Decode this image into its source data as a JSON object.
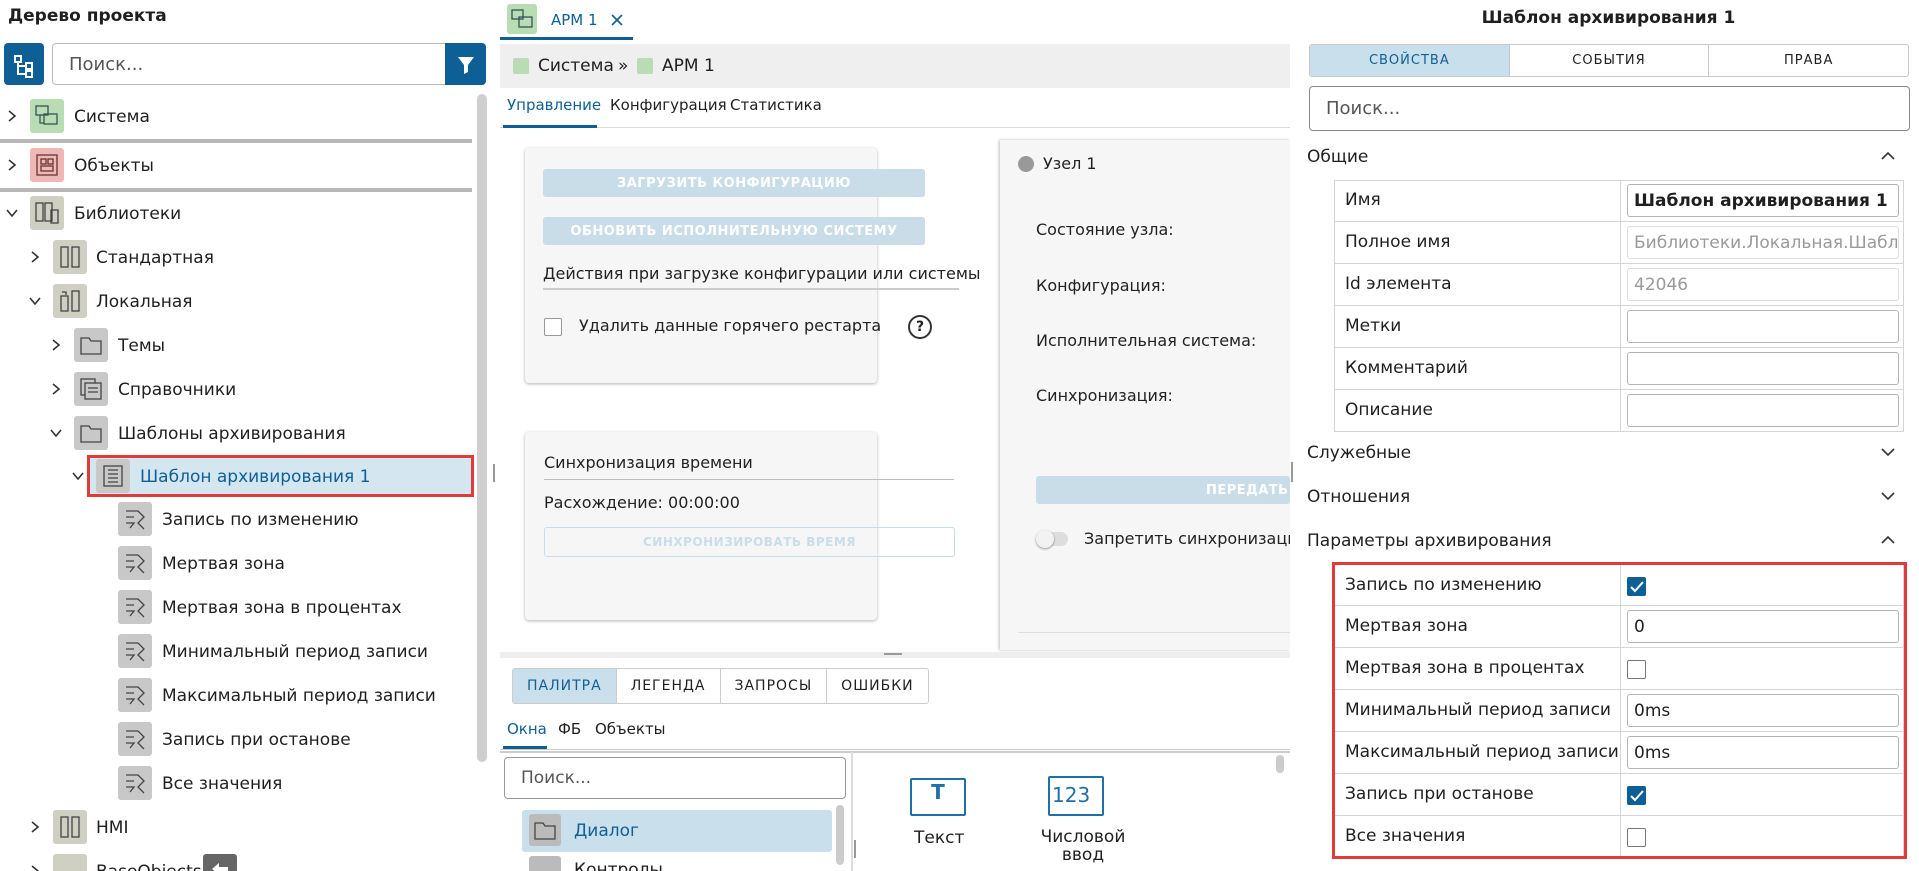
{
  "left_panel": {
    "title": "Дерево проекта",
    "search_placeholder": "Поиск...",
    "tree": {
      "sistema": "Система",
      "objects": "Объекты",
      "libraries": "Библиотеки",
      "standard": "Стандартная",
      "local": "Локальная",
      "themes": "Темы",
      "references": "Справочники",
      "archive_templates": "Шаблоны архивирования",
      "archive_template_1": "Шаблон архивирования 1",
      "children": [
        "Запись по изменению",
        "Мертвая зона",
        "Мертвая зона в процентах",
        "Минимальный период записи",
        "Максимальный период записи",
        "Запись при останове",
        "Все значения"
      ],
      "hmi": "HMI",
      "base_objects": "BaseObjects"
    }
  },
  "middle": {
    "tab_title": "АРМ 1",
    "breadcrumb": [
      "Система",
      "»",
      "АРМ 1"
    ],
    "subtabs": [
      "Управление",
      "Конфигурация",
      "Статистика"
    ],
    "load_config_btn": "ЗАГРУЗИТЬ КОНФИГУРАЦИЮ",
    "update_exec_btn": "ОБНОВИТЬ ИСПОЛНИТЕЛЬНУЮ СИСТЕМУ",
    "actions_label": "Действия при загрузке конфигурации или системы",
    "delete_hot_restart": "Удалить данные горячего рестарта",
    "help_icon_text": "?",
    "time_sync_title": "Синхронизация времени",
    "divergence": "Расхождение: 00:00:00",
    "sync_time_btn": "СИНХРОНИЗИРОВАТЬ ВРЕМЯ",
    "node_title": "Узел 1",
    "node_fields": [
      "Состояние узла:",
      "Конфигурация:",
      "Исполнительная система:",
      "Синхронизация:"
    ],
    "transfer_btn": "ПЕРЕДАТЬ",
    "forbid_sync": "Запретить синхронизаци",
    "bottom_tabs": [
      "ПАЛИТРА",
      "ЛЕГЕНДА",
      "ЗАПРОСЫ",
      "ОШИБКИ"
    ],
    "bottom_subtabs": [
      "Окна",
      "ФБ",
      "Объекты"
    ],
    "bottom_search_placeholder": "Поиск...",
    "list_items": [
      "Диалог",
      "Контролы"
    ],
    "palette_items": [
      "Текст",
      "Числовой ввод"
    ],
    "text_icon_glyph": "T",
    "numeric_icon_glyph": "123"
  },
  "right_panel": {
    "title": "Шаблон архивирования 1",
    "tabs": [
      "СВОЙСТВА",
      "СОБЫТИЯ",
      "ПРАВА"
    ],
    "search_placeholder": "Поиск...",
    "sections": {
      "general": "Общие",
      "service": "Служебные",
      "relations": "Отношения",
      "archive_params": "Параметры архивирования"
    },
    "general_props": [
      {
        "key": "Имя",
        "value": "Шаблон архивирования 1"
      },
      {
        "key": "Полное имя",
        "value": "Библиотеки.Локальная.Шаблоны"
      },
      {
        "key": "Id элемента",
        "value": "42046"
      },
      {
        "key": "Метки",
        "value": ""
      },
      {
        "key": "Комментарий",
        "value": ""
      },
      {
        "key": "Описание",
        "value": ""
      }
    ],
    "archive_props": [
      {
        "key": "Запись по изменению",
        "type": "checkbox",
        "checked": true
      },
      {
        "key": "Мертвая зона",
        "type": "text",
        "value": "0"
      },
      {
        "key": "Мертвая зона в процентах",
        "type": "checkbox",
        "checked": false
      },
      {
        "key": "Минимальный период записи",
        "type": "text",
        "value": "0ms"
      },
      {
        "key": "Максимальный период записи",
        "type": "text",
        "value": "0ms"
      },
      {
        "key": "Запись при останове",
        "type": "checkbox",
        "checked": true
      },
      {
        "key": "Все значения",
        "type": "checkbox",
        "checked": false
      }
    ]
  },
  "colors": {
    "accent": "#0d5f95",
    "highlight_border": "#e03a3a",
    "selection": "#d4e6f0"
  }
}
